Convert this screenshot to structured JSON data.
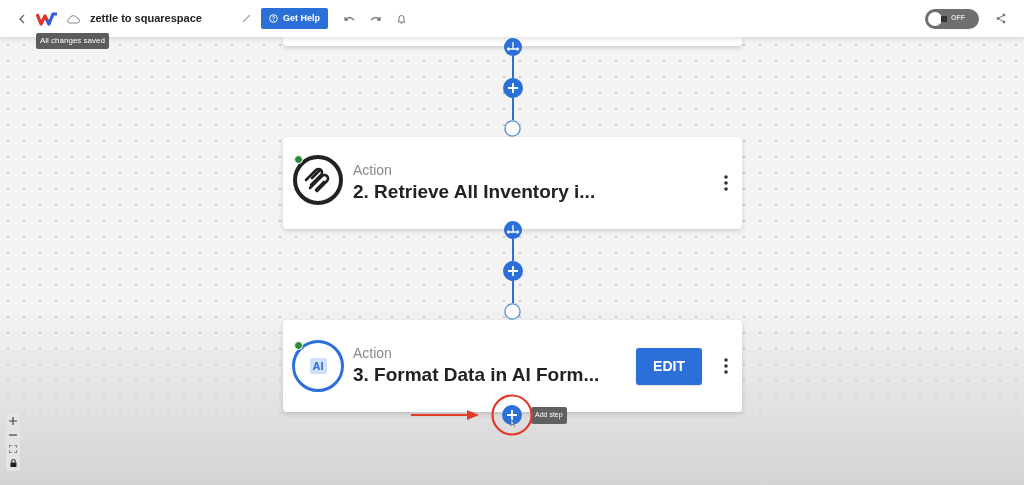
{
  "header": {
    "title": "zettle to squarespace",
    "save_tooltip": "All changes saved",
    "help_button": "Get Help",
    "toggle": {
      "label": "OFF",
      "on": false
    }
  },
  "steps": [
    {
      "kind": "clipped"
    },
    {
      "kind": "spiral",
      "type": "Action",
      "title": "2. Retrieve All Inventory i...",
      "online": true
    },
    {
      "kind": "ai",
      "badge": "AI",
      "type": "Action",
      "title": "3. Format Data in AI Form...",
      "online": true,
      "edit_button": "EDIT"
    }
  ],
  "add_step": {
    "tooltip": "Add step",
    "highlighted": true
  }
}
